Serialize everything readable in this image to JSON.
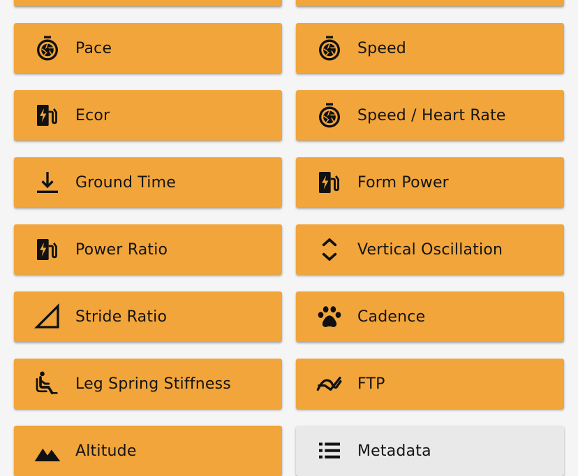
{
  "metrics": {
    "pace": {
      "label": "Pace",
      "icon": "stopwatch-icon"
    },
    "speed": {
      "label": "Speed",
      "icon": "stopwatch-icon"
    },
    "ecor": {
      "label": "Ecor",
      "icon": "ev-station-icon"
    },
    "speed_hr": {
      "label": "Speed / Heart Rate",
      "icon": "stopwatch-icon"
    },
    "ground_time": {
      "label": "Ground Time",
      "icon": "vertical-align-bottom-icon"
    },
    "form_power": {
      "label": "Form Power",
      "icon": "ev-station-icon"
    },
    "power_ratio": {
      "label": "Power Ratio",
      "icon": "ev-station-icon"
    },
    "vertical_osc": {
      "label": "Vertical Oscillation",
      "icon": "unfold-icon"
    },
    "stride_ratio": {
      "label": "Stride Ratio",
      "icon": "triangle-icon"
    },
    "cadence": {
      "label": "Cadence",
      "icon": "paw-icon"
    },
    "leg_spring": {
      "label": "Leg Spring Stiffness",
      "icon": "seated-person-icon"
    },
    "ftp": {
      "label": "FTP",
      "icon": "trending-icon"
    },
    "altitude": {
      "label": "Altitude",
      "icon": "mountains-icon"
    },
    "metadata": {
      "label": "Metadata",
      "icon": "list-icon"
    }
  },
  "colors": {
    "card": "#f2a53a",
    "card_secondary": "#e9e9ea",
    "background": "#f5f5f5",
    "text": "#141414"
  }
}
